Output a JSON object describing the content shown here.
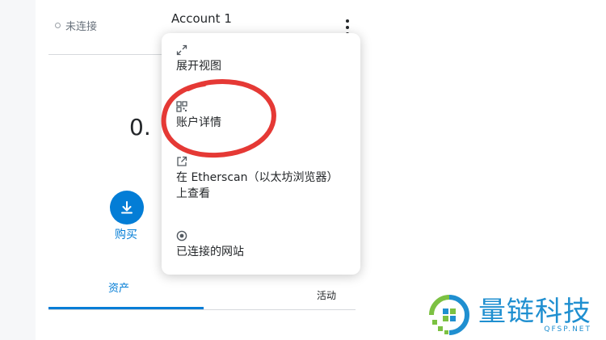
{
  "header": {
    "status_text": "未连接",
    "account_name": "Account 1"
  },
  "balance": {
    "amount_text": "0."
  },
  "actions": {
    "buy_label": "购买"
  },
  "tabs": [
    {
      "label": "资产",
      "selected": true
    },
    {
      "label": "活动",
      "selected": false
    }
  ],
  "menu": {
    "items": [
      {
        "label": "展开视图",
        "icon": "expand-icon"
      },
      {
        "label": "账户详情",
        "icon": "qr-code-icon"
      },
      {
        "label": "在 Etherscan（以太坊浏览器）上查看",
        "icon": "external-link-icon"
      },
      {
        "label": "已连接的网站",
        "icon": "connected-sites-icon"
      }
    ]
  },
  "watermark": {
    "brand_name": "量链科技",
    "url": "QFSP.NET"
  },
  "colors": {
    "accent": "#037dd6",
    "annotation": "#e53935",
    "brand": "#1f8fd0"
  }
}
